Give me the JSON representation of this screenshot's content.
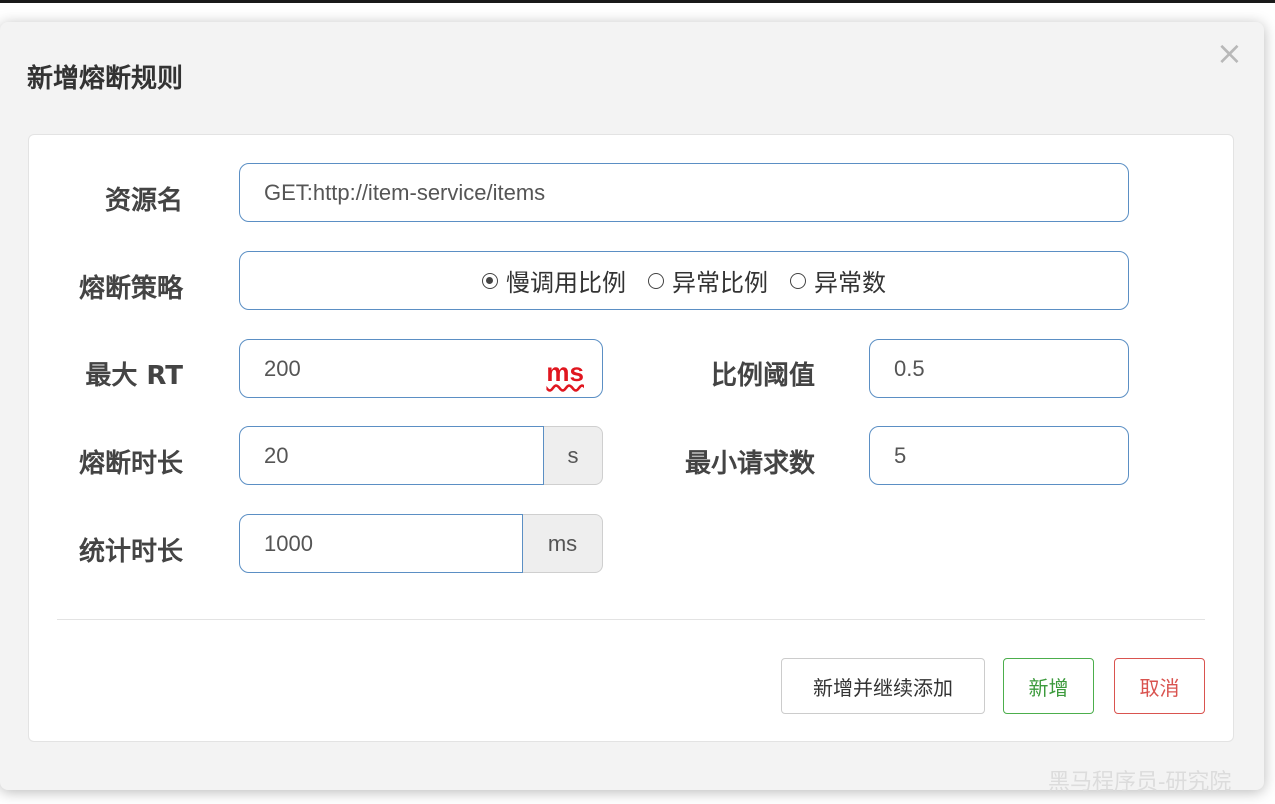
{
  "dialog": {
    "title": "新增熔断规则",
    "close_label": "×"
  },
  "form": {
    "resource": {
      "label": "资源名",
      "value": "GET:http://item-service/items"
    },
    "strategy": {
      "label": "熔断策略",
      "options": [
        "慢调用比例",
        "异常比例",
        "异常数"
      ],
      "selected": "慢调用比例"
    },
    "max_rt": {
      "label": "最大 RT",
      "value": "200",
      "unit": "ms"
    },
    "ratio_threshold": {
      "label": "比例阈值",
      "value": "0.5"
    },
    "break_duration": {
      "label": "熔断时长",
      "value": "20",
      "unit": "s"
    },
    "min_requests": {
      "label": "最小请求数",
      "value": "5"
    },
    "stat_duration": {
      "label": "统计时长",
      "value": "1000",
      "unit": "ms"
    }
  },
  "buttons": {
    "add_and_continue": "新增并继续添加",
    "add": "新增",
    "cancel": "取消"
  },
  "watermark": "黑马程序员-研究院",
  "colors": {
    "input_border": "#5b8fc4",
    "success": "#4cae4c",
    "danger": "#d9534f",
    "unit_highlight": "#e0161f"
  }
}
